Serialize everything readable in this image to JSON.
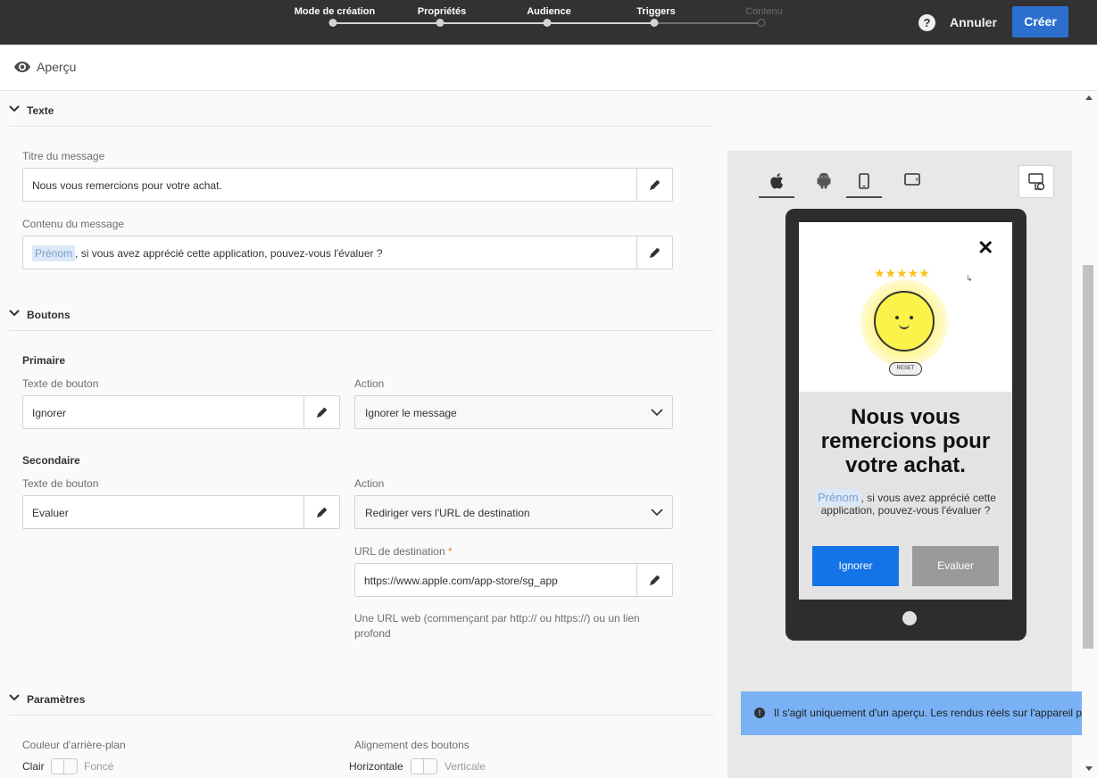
{
  "wizard": {
    "steps": [
      {
        "label": "Mode de création"
      },
      {
        "label": "Propriétés"
      },
      {
        "label": "Audience"
      },
      {
        "label": "Triggers"
      },
      {
        "label": "Contenu"
      }
    ],
    "help_label": "?",
    "cancel_label": "Annuler",
    "create_label": "Créer"
  },
  "header": {
    "title": "Aperçu"
  },
  "sections": {
    "texte": {
      "title": "Texte",
      "message_title_label": "Titre du message",
      "message_title_value": "Nous vous remercions pour votre achat.",
      "message_content_label": "Contenu du message",
      "message_content_token": "Prénom",
      "message_content_rest": ", si vous avez apprécié cette application, pouvez-vous l'évaluer ?"
    },
    "boutons": {
      "title": "Boutons",
      "primary": {
        "title": "Primaire",
        "text_label": "Texte de bouton",
        "text_value": "Ignorer",
        "action_label": "Action",
        "action_value": "Ignorer le message"
      },
      "secondary": {
        "title": "Secondaire",
        "text_label": "Texte de bouton",
        "text_value": "Evaluer",
        "action_label": "Action",
        "action_value": "Rediriger vers l'URL de destination",
        "url_label": "URL de destination",
        "url_required": "*",
        "url_value": "https://www.apple.com/app-store/sg_app",
        "url_hint": "Une URL web (commençant par http:// ou https://) ou un lien profond"
      }
    },
    "parametres": {
      "title": "Paramètres",
      "bg_color_label": "Couleur d'arrière-plan",
      "bg_color_on": "Clair",
      "bg_color_off": "Foncé",
      "btn_align_label": "Alignement des boutons",
      "btn_align_on": "Horizontale",
      "btn_align_off": "Verticale"
    }
  },
  "preview": {
    "os_tabs": [
      {
        "icon": "apple-icon",
        "active": true
      },
      {
        "icon": "android-icon",
        "active": false
      },
      {
        "icon": "phone-icon",
        "active": true
      },
      {
        "icon": "tablet-icon",
        "active": false
      }
    ],
    "close_glyph": "✕",
    "stars": "★★★★★",
    "reset_label": "RESET",
    "title": "Nous vous remercions pour votre achat.",
    "body_token": "Prénom",
    "body_rest": ", si vous avez apprécié cette application, pouvez-vous l'évaluer ?",
    "primary_button": "Ignorer",
    "secondary_button": "Evaluer",
    "colors": {
      "primary": "#1473e6",
      "secondary": "#9a9a9a"
    }
  },
  "toast": {
    "icon": "info-icon",
    "message": "Il s'agit uniquement d'un aperçu. Les rendus réels sur l'appareil peuvent varier."
  },
  "colors": {
    "topbar": "#323232",
    "accent": "#2d6fcf",
    "toast": "#7ab1f5"
  }
}
